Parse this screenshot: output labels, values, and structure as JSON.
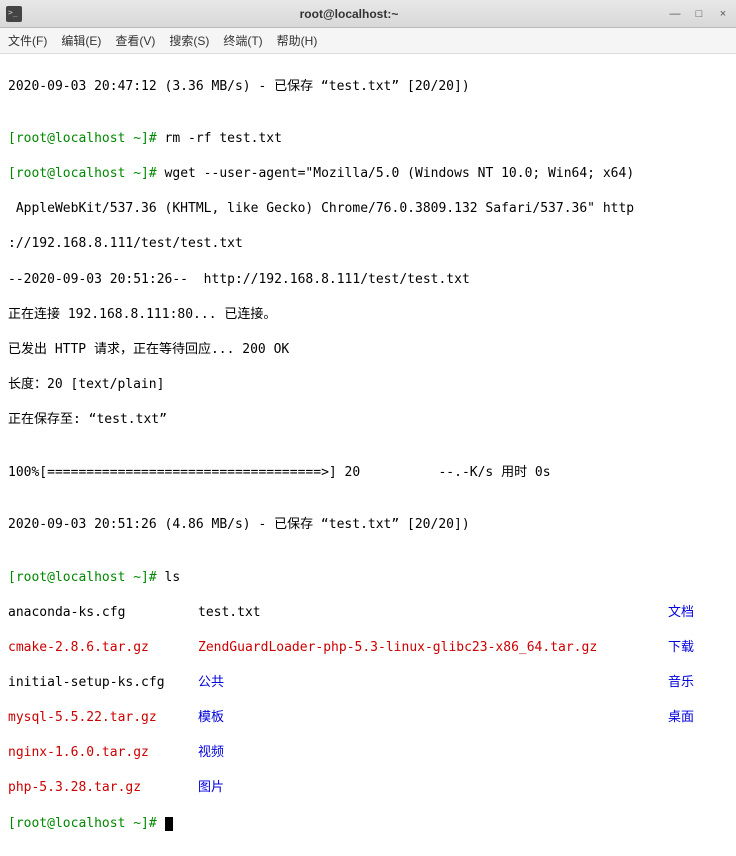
{
  "titlebar": {
    "title": "root@localhost:~"
  },
  "win": {
    "min": "—",
    "max": "□",
    "close": "×"
  },
  "menu": {
    "file": "文件(F)",
    "edit": "编辑(E)",
    "view": "查看(V)",
    "search": "搜索(S)",
    "terminal": "终端(T)",
    "help": "帮助(H)"
  },
  "term": {
    "l1": "2020-09-03 20:47:12 (3.36 MB/s) - 已保存 “test.txt” [20/20])",
    "blank": "",
    "p1": "[root@localhost ~]# ",
    "c1": "rm -rf test.txt",
    "c2a": "wget --user-agent=\"Mozilla/5.0 (Windows NT 10.0; Win64; x64)",
    "c2b": " AppleWebKit/537.36 (KHTML, like Gecko) Chrome/76.0.3809.132 Safari/537.36\" http",
    "c2c": "://192.168.8.111/test/test.txt",
    "o1": "--2020-09-03 20:51:26--  http://192.168.8.111/test/test.txt",
    "o2": "正在连接 192.168.8.111:80... 已连接。",
    "o3": "已发出 HTTP 请求，正在等待回应... 200 OK",
    "o4": "长度：20 [text/plain]",
    "o5": "正在保存至: “test.txt”",
    "progress": "100%[===================================>] 20          --.-K/s 用时 0s",
    "o6": "2020-09-03 20:51:26 (4.86 MB/s) - 已保存 “test.txt” [20/20])",
    "c3": "ls",
    "ls": {
      "r0": {
        "a": "anaconda-ks.cfg",
        "b": "test.txt",
        "c": "文档"
      },
      "r1": {
        "a": "cmake-2.8.6.tar.gz",
        "b": "ZendGuardLoader-php-5.3-linux-glibc23-x86_64.tar.gz",
        "c": "下载"
      },
      "r2": {
        "a": "initial-setup-ks.cfg",
        "b": "公共",
        "c": "音乐"
      },
      "r3": {
        "a": "mysql-5.5.22.tar.gz",
        "b": "模板",
        "c": "桌面"
      },
      "r4": {
        "a": "nginx-1.6.0.tar.gz",
        "b": "视频",
        "c": ""
      },
      "r5": {
        "a": "php-5.3.28.tar.gz",
        "b": "图片",
        "c": ""
      }
    },
    "p_last": "[root@localhost ~]# "
  }
}
